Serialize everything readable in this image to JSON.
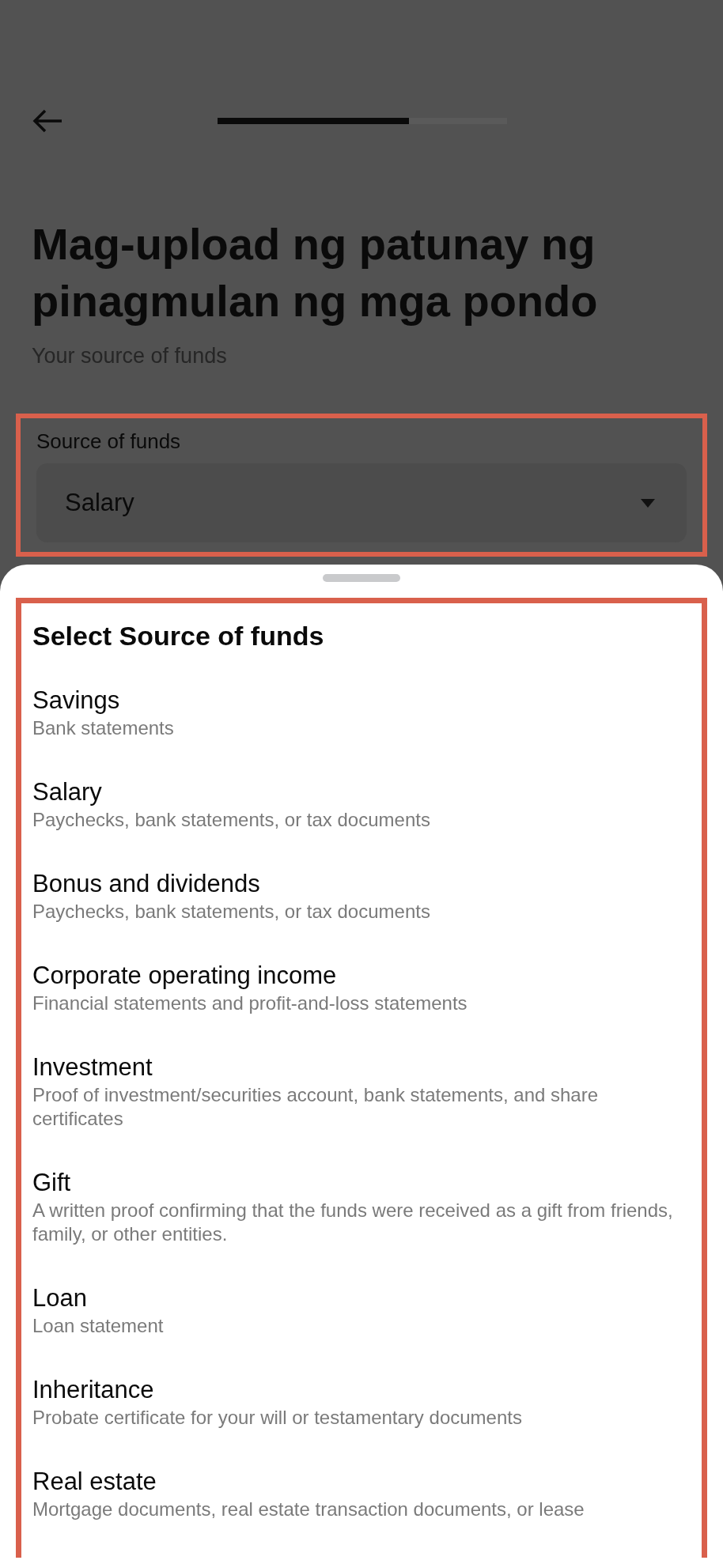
{
  "header": {
    "progress": {
      "level": 0.66
    }
  },
  "title": "Mag-upload ng patunay ng pinagmulan ng mga pondo",
  "subtitle": "Your source of funds",
  "source_field": {
    "label": "Source of funds",
    "value": "Salary",
    "highlighted": true
  },
  "sheet": {
    "title": "Select Source of funds",
    "highlighted": true,
    "options": [
      {
        "title": "Savings",
        "description": "Bank statements"
      },
      {
        "title": "Salary",
        "description": "Paychecks, bank statements, or tax documents"
      },
      {
        "title": "Bonus and dividends",
        "description": "Paychecks, bank statements, or tax documents"
      },
      {
        "title": "Corporate operating income",
        "description": "Financial statements and profit-and-loss statements"
      },
      {
        "title": "Investment",
        "description": "Proof of investment/securities account, bank statements, and share certificates"
      },
      {
        "title": "Gift",
        "description": "A written proof confirming that the funds were received as a gift from friends, family, or other entities."
      },
      {
        "title": "Loan",
        "description": "Loan statement"
      },
      {
        "title": "Inheritance",
        "description": "Probate certificate for your will or testamentary documents"
      },
      {
        "title": "Real estate",
        "description": "Mortgage documents, real estate transaction documents, or lease"
      }
    ]
  }
}
